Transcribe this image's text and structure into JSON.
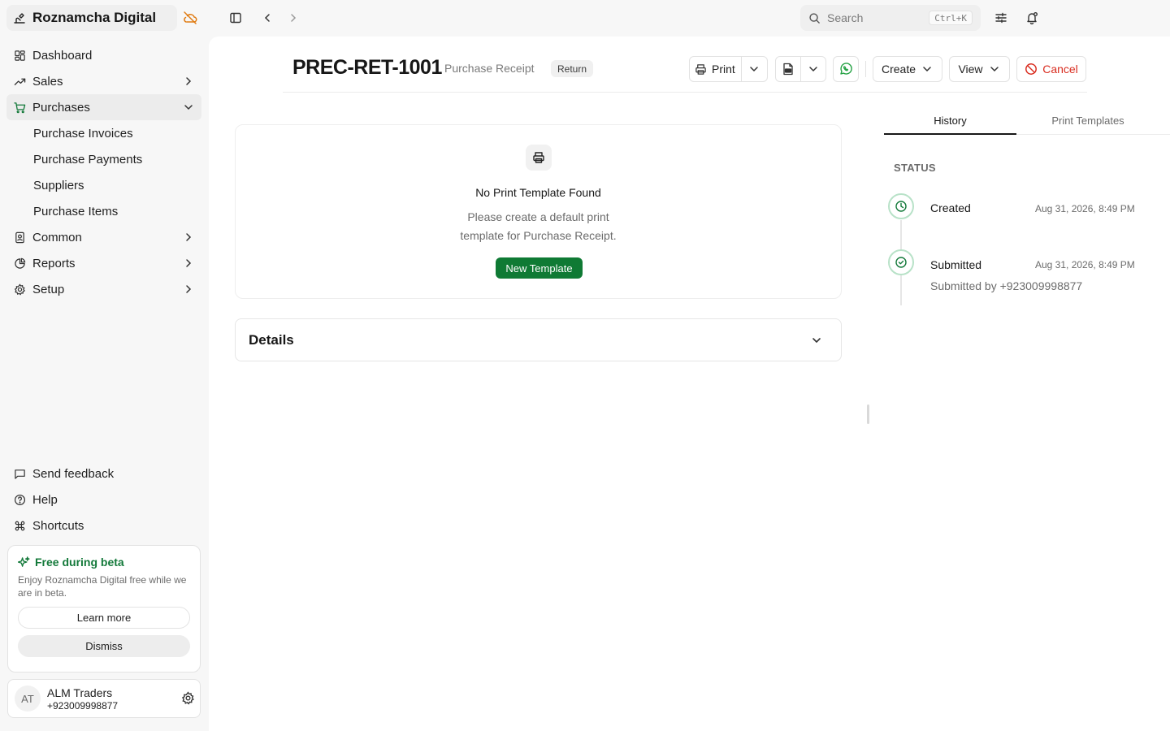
{
  "app": {
    "name": "Roznamcha Digital"
  },
  "sidebar": {
    "items": [
      {
        "label": "Dashboard"
      },
      {
        "label": "Sales"
      },
      {
        "label": "Purchases"
      },
      {
        "label": "Purchase Invoices"
      },
      {
        "label": "Purchase Payments"
      },
      {
        "label": "Suppliers"
      },
      {
        "label": "Purchase Items"
      },
      {
        "label": "Common"
      },
      {
        "label": "Reports"
      },
      {
        "label": "Setup"
      }
    ],
    "bottom_links": [
      {
        "label": "Send feedback"
      },
      {
        "label": "Help"
      },
      {
        "label": "Shortcuts"
      }
    ],
    "beta": {
      "title": "Free during beta",
      "description": "Enjoy Roznamcha Digital free while we are in beta.",
      "learn_more": "Learn more",
      "dismiss": "Dismiss"
    },
    "user": {
      "initials": "AT",
      "name": "ALM Traders",
      "phone": "+923009998877"
    }
  },
  "topbar": {
    "search_placeholder": "Search",
    "search_shortcut": "Ctrl+K"
  },
  "document": {
    "id": "PREC-RET-1001",
    "type": "Purchase Receipt",
    "badge": "Return"
  },
  "toolbar": {
    "print": "Print",
    "create": "Create",
    "view": "View",
    "cancel": "Cancel",
    "cancel_color": "#d92d20",
    "whatsapp_color": "#25a244"
  },
  "print_template": {
    "title": "No Print Template Found",
    "description_line1": "Please create a default print",
    "description_line2": "template for Purchase Receipt.",
    "new_button": "New Template",
    "button_color": "#0f7a34"
  },
  "details": {
    "title": "Details"
  },
  "right_panel": {
    "tabs": [
      {
        "label": "History"
      },
      {
        "label": "Print Templates"
      }
    ],
    "status_label": "STATUS",
    "timeline": [
      {
        "title": "Created",
        "time": "Aug 31, 2026, 8:49 PM"
      },
      {
        "title": "Submitted",
        "time": "Aug 31, 2026, 8:49 PM",
        "sub": "Submitted by +923009998877"
      }
    ]
  }
}
